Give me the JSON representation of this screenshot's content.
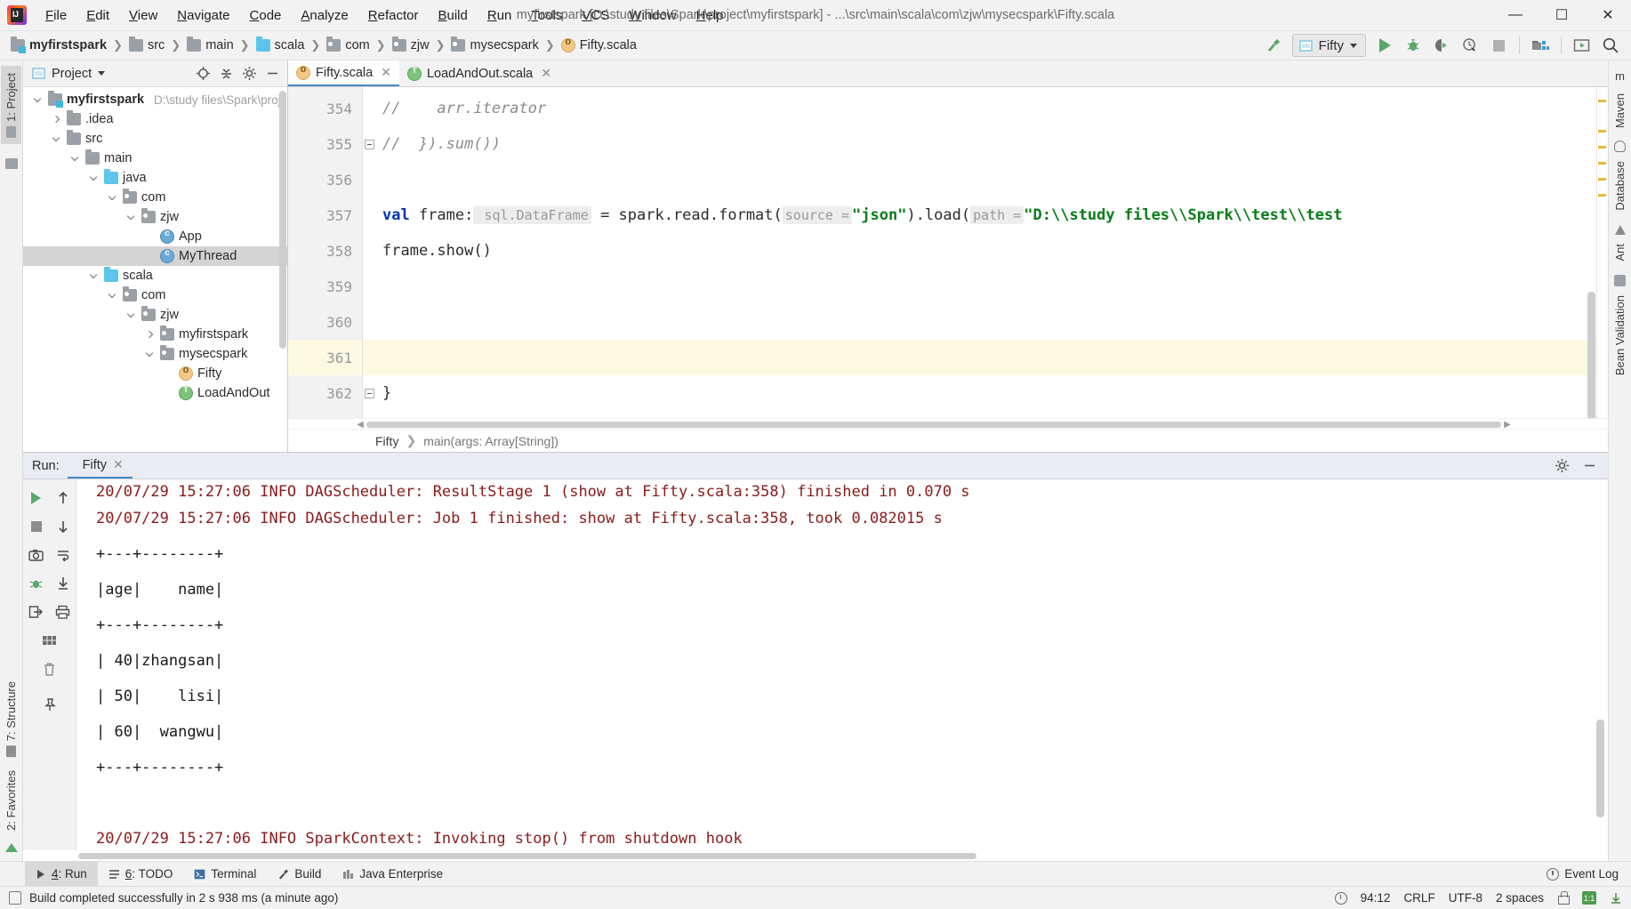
{
  "window": {
    "title": "myfirstspark [D:\\study files\\Spark\\project\\myfirstspark] - ...\\src\\main\\scala\\com\\zjw\\mysecspark\\Fifty.scala",
    "minimize": "—",
    "maximize": "☐",
    "close": "✕"
  },
  "menubar": [
    {
      "label": "File"
    },
    {
      "label": "Edit"
    },
    {
      "label": "View"
    },
    {
      "label": "Navigate"
    },
    {
      "label": "Code"
    },
    {
      "label": "Analyze"
    },
    {
      "label": "Refactor"
    },
    {
      "label": "Build"
    },
    {
      "label": "Run"
    },
    {
      "label": "Tools"
    },
    {
      "label": "VCS"
    },
    {
      "label": "Window"
    },
    {
      "label": "Help"
    }
  ],
  "navbar": {
    "crumbs": [
      {
        "label": "myfirstspark",
        "icon": "module-icon"
      },
      {
        "label": "src",
        "icon": "folder-icon"
      },
      {
        "label": "main",
        "icon": "folder-icon"
      },
      {
        "label": "scala",
        "icon": "source-folder-icon"
      },
      {
        "label": "com",
        "icon": "package-icon"
      },
      {
        "label": "zjw",
        "icon": "package-icon"
      },
      {
        "label": "mysecspark",
        "icon": "package-icon"
      },
      {
        "label": "Fifty.scala",
        "icon": "scala-object-icon"
      }
    ],
    "separator": "❯",
    "run_config": "Fifty"
  },
  "left_strip": [
    {
      "label": "1: Project"
    }
  ],
  "right_strip": [
    {
      "label": "m"
    },
    {
      "label": "Maven"
    },
    {
      "label": "Database"
    },
    {
      "label": "Ant"
    },
    {
      "label": "Bean Validation"
    }
  ],
  "project_panel": {
    "title": "Project",
    "tree": [
      {
        "label": "myfirstspark",
        "path": "D:\\study files\\Spark\\project",
        "depth": 0,
        "arrow": "down",
        "icon": "module-icon",
        "bold": true,
        "selected": false
      },
      {
        "label": ".idea",
        "path": "",
        "depth": 1,
        "arrow": "right",
        "icon": "folder-icon",
        "bold": false,
        "selected": false
      },
      {
        "label": "src",
        "path": "",
        "depth": 1,
        "arrow": "down",
        "icon": "folder-icon",
        "bold": false,
        "selected": false
      },
      {
        "label": "main",
        "path": "",
        "depth": 2,
        "arrow": "down",
        "icon": "folder-icon",
        "bold": false,
        "selected": false
      },
      {
        "label": "java",
        "path": "",
        "depth": 3,
        "arrow": "down",
        "icon": "source-folder-icon",
        "bold": false,
        "selected": false
      },
      {
        "label": "com",
        "path": "",
        "depth": 4,
        "arrow": "down",
        "icon": "package-icon",
        "bold": false,
        "selected": false
      },
      {
        "label": "zjw",
        "path": "",
        "depth": 5,
        "arrow": "down",
        "icon": "package-icon",
        "bold": false,
        "selected": false
      },
      {
        "label": "App",
        "path": "",
        "depth": 6,
        "arrow": "none",
        "icon": "scala-class-runnable-icon",
        "bold": false,
        "selected": false
      },
      {
        "label": "MyThread",
        "path": "",
        "depth": 6,
        "arrow": "none",
        "icon": "scala-class-icon",
        "bold": false,
        "selected": true
      },
      {
        "label": "scala",
        "path": "",
        "depth": 3,
        "arrow": "down",
        "icon": "source-folder-icon",
        "bold": false,
        "selected": false
      },
      {
        "label": "com",
        "path": "",
        "depth": 4,
        "arrow": "down",
        "icon": "package-icon",
        "bold": false,
        "selected": false
      },
      {
        "label": "zjw",
        "path": "",
        "depth": 5,
        "arrow": "down",
        "icon": "package-icon",
        "bold": false,
        "selected": false
      },
      {
        "label": "myfirstspark",
        "path": "",
        "depth": 6,
        "arrow": "right",
        "icon": "package-icon",
        "bold": false,
        "selected": false
      },
      {
        "label": "mysecspark",
        "path": "",
        "depth": 6,
        "arrow": "down",
        "icon": "package-icon",
        "bold": false,
        "selected": false
      },
      {
        "label": "Fifty",
        "path": "",
        "depth": 7,
        "arrow": "none",
        "icon": "scala-object-icon",
        "bold": false,
        "selected": false
      },
      {
        "label": "LoadAndOut",
        "path": "",
        "depth": 7,
        "arrow": "none",
        "icon": "scala-trait-icon",
        "bold": false,
        "selected": false
      }
    ]
  },
  "editor": {
    "tabs": [
      {
        "label": "Fifty.scala",
        "icon": "scala-object-icon",
        "active": true,
        "close": "✕"
      },
      {
        "label": "LoadAndOut.scala",
        "icon": "scala-trait-icon",
        "active": false,
        "close": "✕"
      }
    ],
    "lines": [
      {
        "number": "354",
        "highlight": false,
        "fold": false
      },
      {
        "number": "355",
        "highlight": false,
        "fold": true
      },
      {
        "number": "356",
        "highlight": false,
        "fold": false
      },
      {
        "number": "357",
        "highlight": false,
        "fold": false
      },
      {
        "number": "358",
        "highlight": false,
        "fold": false
      },
      {
        "number": "359",
        "highlight": false,
        "fold": false
      },
      {
        "number": "360",
        "highlight": false,
        "fold": false
      },
      {
        "number": "361",
        "highlight": true,
        "fold": false
      },
      {
        "number": "362",
        "highlight": false,
        "fold": true
      }
    ],
    "code": {
      "l354_comment": "//",
      "l354_text": "    arr.iterator",
      "l355_comment": "//",
      "l355_text": "  }).sum())",
      "l357_kw": "val",
      "l357_name": " frame",
      "l357_colon": ":",
      "l357_type": " sql.DataFrame",
      "l357_eq": " = spark.read.format(",
      "l357_hint_source": "source =",
      "l357_json": "\"json\"",
      "l357_load": ").load(",
      "l357_hint_path": "path =",
      "l357_path": "\"D:\\\\study files\\\\Spark\\\\test\\\\test",
      "l358_text": "frame.show()",
      "l362_text": "}"
    },
    "breadcrumbs": [
      {
        "label": "Fifty"
      },
      {
        "label": "main(args: Array[String])"
      }
    ],
    "breadcrumb_sep": "❯"
  },
  "run_panel": {
    "header_label": "Run:",
    "tab_label": "Fifty",
    "tab_close": "✕",
    "console_lines": [
      {
        "text": "20/07/29 15:27:06 INFO DAGScheduler: ResultStage 1 (show at Fifty.scala:358) finished in 0.070 s",
        "type": "log",
        "clipped": true
      },
      {
        "text": "20/07/29 15:27:06 INFO DAGScheduler: Job 1 finished: show at Fifty.scala:358, took 0.082015 s",
        "type": "log",
        "clipped": false
      },
      {
        "text": "+---+--------+",
        "type": "out",
        "clipped": false
      },
      {
        "text": "|age|    name|",
        "type": "out",
        "clipped": false
      },
      {
        "text": "+---+--------+",
        "type": "out",
        "clipped": false
      },
      {
        "text": "| 40|zhangsan|",
        "type": "out",
        "clipped": false
      },
      {
        "text": "| 50|    lisi|",
        "type": "out",
        "clipped": false
      },
      {
        "text": "| 60|  wangwu|",
        "type": "out",
        "clipped": false
      },
      {
        "text": "+---+--------+",
        "type": "out",
        "clipped": false
      },
      {
        "text": "",
        "type": "out",
        "clipped": false
      },
      {
        "text": "20/07/29 15:27:06 INFO SparkContext: Invoking stop() from shutdown hook",
        "type": "log",
        "clipped": false
      }
    ]
  },
  "bottom_tabs": [
    {
      "num": "4",
      "label": ": Run",
      "icon": "run-icon",
      "active": true
    },
    {
      "num": "6",
      "label": ": TODO",
      "icon": "todo-icon",
      "active": false
    },
    {
      "num": "",
      "label": "Terminal",
      "icon": "terminal-icon",
      "active": false
    },
    {
      "num": "",
      "label": "Build",
      "icon": "build-icon",
      "active": false
    },
    {
      "num": "",
      "label": "Java Enterprise",
      "icon": "java-enterprise-icon",
      "active": false
    }
  ],
  "event_log": "Event Log",
  "statusbar": {
    "message": "Build completed successfully in 2 s 938 ms (a minute ago)",
    "caret": "94:12",
    "line_separator": "CRLF",
    "encoding": "UTF-8",
    "indent": "2 spaces"
  },
  "colors": {
    "accent_blue": "#4a88c7",
    "run_green": "#59a869",
    "log_red": "#8b1a1a",
    "string_green": "#067d17",
    "keyword_blue": "#0033b3",
    "highlight_line": "#fcfae2"
  }
}
